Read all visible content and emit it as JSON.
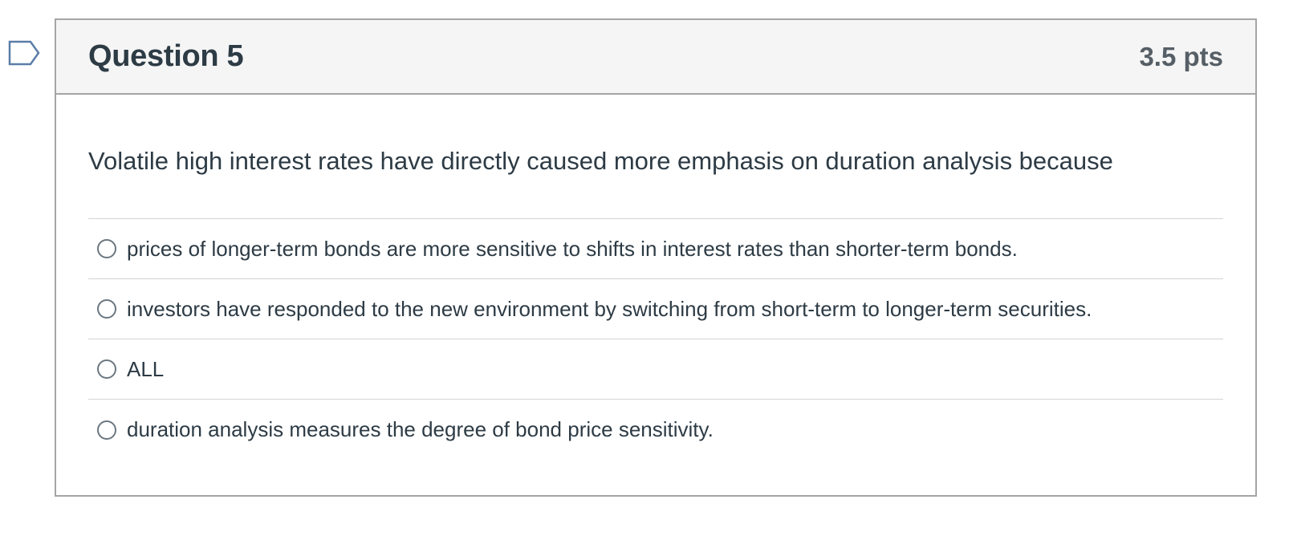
{
  "question": {
    "title": "Question 5",
    "points": "3.5 pts",
    "text": "Volatile high interest rates have directly caused more emphasis on duration analysis because",
    "flag_icon": "bookmark-flag-icon",
    "answers": [
      {
        "label": "prices of longer-term bonds are more sensitive to shifts in interest rates than shorter-term bonds.",
        "selected": false
      },
      {
        "label": "investors have responded to the new environment by switching from short-term to longer-term securities.",
        "selected": false
      },
      {
        "label": "ALL",
        "selected": false
      },
      {
        "label": "duration analysis measures the degree of bond price sensitivity.",
        "selected": false
      }
    ]
  },
  "colors": {
    "header_bg": "#f5f5f5",
    "border": "#a5a5a5",
    "text": "#2d3b45",
    "points_text": "#565f66"
  }
}
